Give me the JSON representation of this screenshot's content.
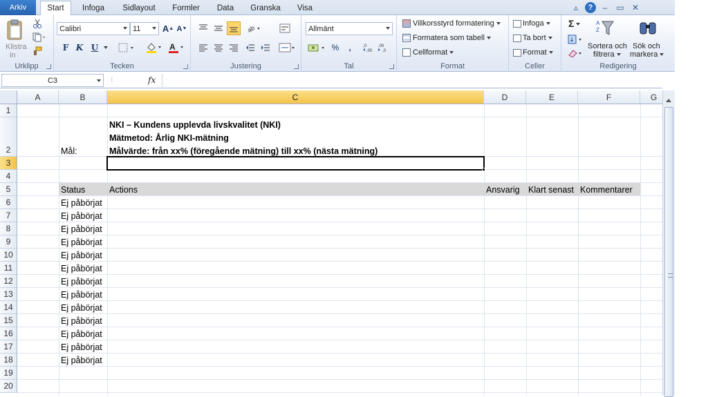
{
  "tabs": {
    "file": "Arkiv",
    "items": [
      "Start",
      "Infoga",
      "Sidlayout",
      "Formler",
      "Data",
      "Granska",
      "Visa"
    ],
    "active": "Start"
  },
  "window_controls": [
    "▵",
    "?",
    "–",
    "▭",
    "✕"
  ],
  "ribbon": {
    "clipboard": {
      "label": "Urklipp",
      "paste": "Klistra",
      "paste2": "in"
    },
    "font": {
      "label": "Tecken",
      "name": "Calibri",
      "size": "11",
      "bold": "F",
      "italic": "K",
      "underline": "U"
    },
    "alignment": {
      "label": "Justering"
    },
    "number": {
      "label": "Tal",
      "format": "Allmänt",
      "percent": "%",
      "comma": ",",
      "inc": ",0→,00",
      "dec": ",00→,0"
    },
    "styles": {
      "label": "Format",
      "conditional": "Villkorsstyrd formatering",
      "as_table": "Formatera som tabell",
      "cell_style": "Cellformat"
    },
    "cells": {
      "label": "Celler",
      "insert": "Infoga",
      "delete": "Ta bort",
      "format": "Format"
    },
    "editing": {
      "label": "Redigering",
      "sigma": "Σ",
      "sort": "Sortera och",
      "sort2": "filtrera",
      "find": "Sök och",
      "find2": "markera"
    }
  },
  "formula_bar": {
    "name_box": "C3",
    "fx": "fx",
    "dots": "⁝",
    "value": ""
  },
  "columns": [
    "A",
    "B",
    "C",
    "D",
    "E",
    "F",
    "G"
  ],
  "selected_column": "C",
  "rows": [
    "1",
    "2",
    "3",
    "4",
    "5",
    "6",
    "7",
    "8",
    "9",
    "10",
    "11",
    "12",
    "13",
    "14",
    "15",
    "16",
    "17",
    "18",
    "19",
    "20"
  ],
  "selected_row": "3",
  "content": {
    "goal_label": "Mål:",
    "line1": "NKI – Kundens upplevda livskvalitet (NKI)",
    "line2": "Mätmetod: Årlig NKI-mätning",
    "line3": "Målvärde: från xx% (föregående mätning) till xx% (nästa mätning)",
    "headers": [
      "Status",
      "Actions",
      "Ansvarig",
      "Klart senast",
      "Kommentarer"
    ],
    "status_values": [
      "Ej påbörjat",
      "Ej påbörjat",
      "Ej påbörjat",
      "Ej påbörjat",
      "Ej påbörjat",
      "Ej påbörjat",
      "Ej påbörjat",
      "Ej påbörjat",
      "Ej påbörjat",
      "Ej påbörjat",
      "Ej påbörjat",
      "Ej påbörjat",
      "Ej påbörjat"
    ]
  }
}
